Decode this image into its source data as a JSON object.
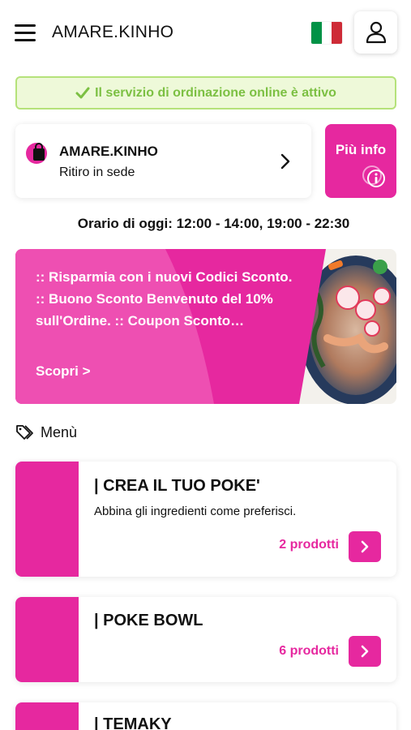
{
  "header": {
    "brand": "AMARE.KINHO",
    "flag_colors": [
      "#009246",
      "#ffffff",
      "#ce2b37"
    ]
  },
  "status": {
    "text": "Il servizio di ordinazione online è attivo"
  },
  "store": {
    "name": "AMARE.KINHO",
    "mode": "Ritiro in sede"
  },
  "info_button": {
    "label": "Più info"
  },
  "hours": {
    "text": "Orario di oggi: 12:00 - 14:00, 19:00 - 22:30"
  },
  "promo": {
    "text": ":: Risparmia con i nuovi Codici Sconto. :: Buono Sconto Benvenuto del 10% sull'Ordine. :: Coupon Sconto…",
    "link": "Scopri >"
  },
  "menu": {
    "heading": "Menù",
    "categories": [
      {
        "title": "| CREA IL TUO POKE'",
        "description": "Abbina gli ingredienti come preferisci.",
        "count": "2 prodotti"
      },
      {
        "title": "| POKE BOWL",
        "description": "",
        "count": "6 prodotti"
      },
      {
        "title": "| TEMAKY",
        "description": "",
        "count": ""
      }
    ]
  },
  "colors": {
    "accent": "#e6289f",
    "status_border": "#b5e27a",
    "status_bg": "#eef9d9",
    "status_text": "#7cc043"
  },
  "icons": {
    "menu": "hamburger-icon",
    "user": "user-icon",
    "check": "check-icon",
    "bag": "shopping-bag-icon",
    "chevron": "chevron-right-icon",
    "info": "info-icon",
    "tag": "tag-icon"
  }
}
